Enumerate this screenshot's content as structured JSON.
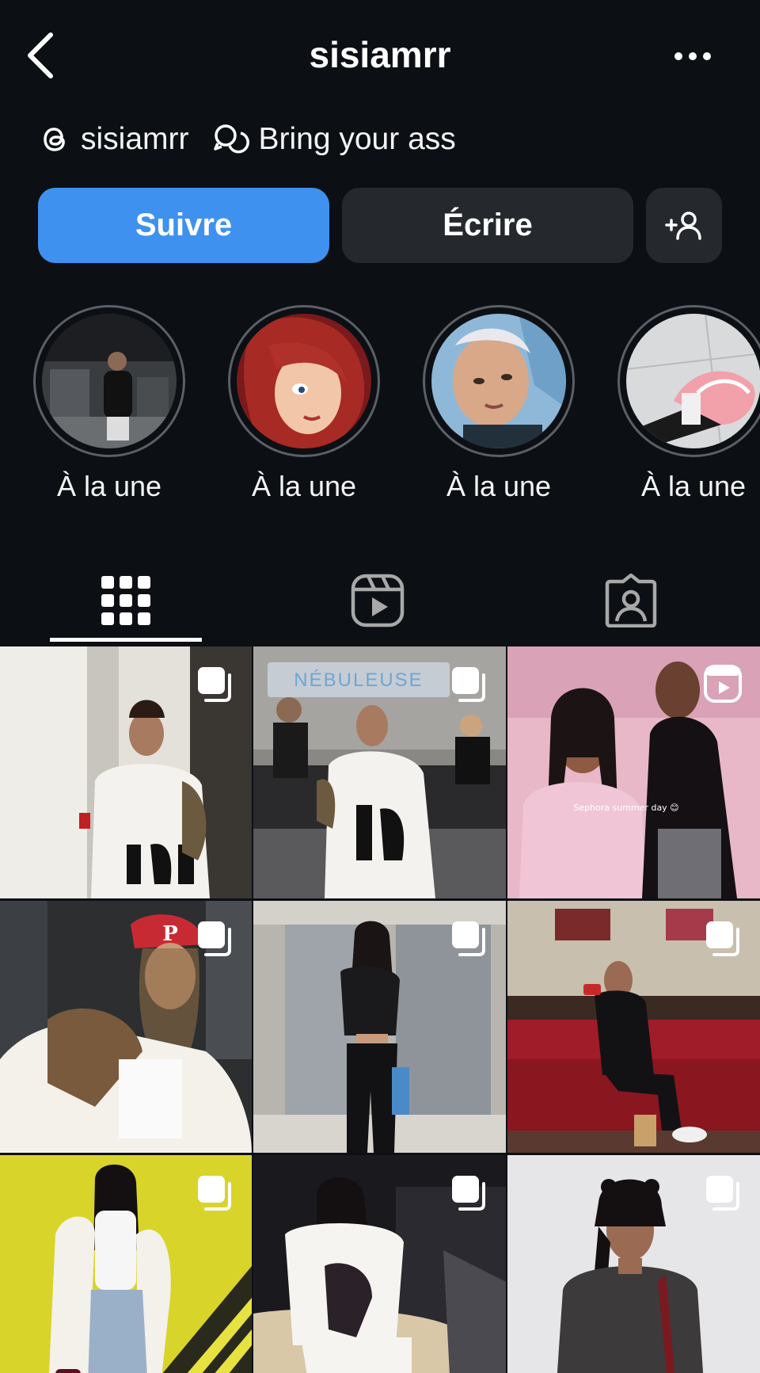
{
  "header": {
    "username": "sisiamrr"
  },
  "links": {
    "threads_handle": "sisiamrr",
    "note_text": "Bring your ass"
  },
  "actions": {
    "follow_label": "Suivre",
    "message_label": "Écrire"
  },
  "highlights": [
    {
      "label": "À la une"
    },
    {
      "label": "À la une"
    },
    {
      "label": "À la une"
    },
    {
      "label": "À la une"
    }
  ],
  "tabs": {
    "active": "posts",
    "items": [
      "posts-grid",
      "reels",
      "tagged"
    ]
  },
  "grid": {
    "post_3_caption": "Sephora summer day 😊",
    "post_1_sign": "NÉBULEUSE"
  },
  "colors": {
    "background": "#0c1014",
    "accent": "#3f91f0",
    "button_dark": "#25292e"
  }
}
